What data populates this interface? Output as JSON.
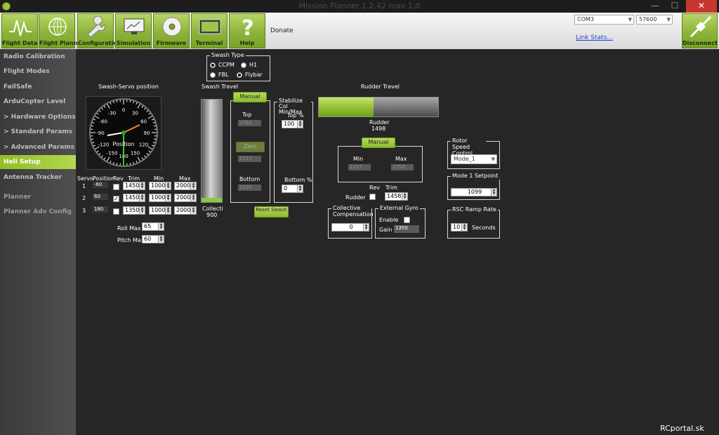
{
  "window": {
    "title": "Mission Planner 1.2.42 mav 1.0",
    "min_label": "—",
    "max_label": "☐",
    "close_label": "✕"
  },
  "toolbar": {
    "buttons": [
      {
        "label": "Flight Data",
        "icon": "pulse-icon"
      },
      {
        "label": "Flight Planner",
        "icon": "globe-icon"
      },
      {
        "label": "Configuration",
        "icon": "wrench-icon"
      },
      {
        "label": "Simulation",
        "icon": "monitor-icon"
      },
      {
        "label": "Firmware",
        "icon": "disc-icon"
      },
      {
        "label": "Terminal",
        "icon": "terminal-icon"
      },
      {
        "label": "Help",
        "icon": "question-icon"
      }
    ],
    "donate": "Donate",
    "port": "COM3",
    "baud": "57600",
    "link_stats": "Link Stats...",
    "disconnect": "Disconnect"
  },
  "sidebar": {
    "items": [
      "Radio Calibration",
      "Flight Modes",
      "FailSafe",
      "ArduCopter Level",
      "> Hardware Options",
      "> Standard Params",
      "> Advanced Params",
      "Heli Setup",
      "Antenna Tracker",
      "Planner",
      "Planner Adv Config"
    ]
  },
  "swash_type": {
    "title": "Swash Type",
    "options": [
      "CCPM",
      "H1",
      "FBL",
      "Flybar"
    ]
  },
  "servo_position": {
    "title": "Swash-Servo position",
    "dial_label": "Position",
    "dial_ticks": [
      "0",
      "30",
      "60",
      "90",
      "120",
      "150",
      "180",
      "-150",
      "-120",
      "-90",
      "-60",
      "-30"
    ]
  },
  "servo_table": {
    "headers": {
      "servo": "Servo",
      "position": "Position",
      "rev": "Rev",
      "trim": "Trim",
      "min": "Min",
      "max": "Max"
    },
    "rows": [
      {
        "num": "1",
        "position": "-60",
        "rev": false,
        "trim": "1450",
        "min": "1000",
        "max": "2000"
      },
      {
        "num": "2",
        "position": "60",
        "rev": true,
        "trim": "1450",
        "min": "1000",
        "max": "2000"
      },
      {
        "num": "3",
        "position": "180",
        "rev": false,
        "trim": "1350",
        "min": "1000",
        "max": "2000"
      }
    ],
    "roll_max_label": "Roll Max",
    "roll_max": "65",
    "pitch_max_label": "Pitch Max",
    "pitch_max": "60"
  },
  "swash_travel": {
    "title": "Swash Travel",
    "collective_label": "Collecti",
    "collective_value": "900",
    "manual": "Manual",
    "top": "Top",
    "top_value": "1783",
    "zero": "Zero",
    "zero_value": "1517",
    "bottom": "Bottom",
    "bottom_value": "1197",
    "reset": "Reset Swash"
  },
  "stabilize": {
    "title": "Stabilize Col Min/Max",
    "top": "Top %",
    "top_value": "100",
    "bottom": "Bottom %",
    "bottom_value": "0"
  },
  "rudder": {
    "title": "Rudder Travel",
    "label": "Rudder",
    "value": "1498",
    "level": 0.46,
    "manual": "Manual",
    "min": "Min",
    "min_value": "1197",
    "max": "Max",
    "max_value": "1750",
    "rev": "Rev",
    "trim": "Trim",
    "trim_value": "1458",
    "row_label": "Rudder"
  },
  "collective_comp": {
    "title": "Collective Compensation",
    "value": "0"
  },
  "external_gyro": {
    "title": "External Gyro",
    "enable": "Enable",
    "gain": "Gain",
    "gain_value": "1350"
  },
  "rotor_speed": {
    "title": "Rotor Speed Control",
    "value": "Mode_1"
  },
  "mode1": {
    "title": "Mode 1 Setpoint",
    "value": "1099"
  },
  "rsc_ramp": {
    "title": "RSC Ramp Rate",
    "value": "10",
    "unit": "Seconds"
  },
  "watermark": "RCportal.sk",
  "colors": {
    "accent": "#92bd2a",
    "bg": "#262626",
    "sidebar": "#4a4a4a"
  }
}
